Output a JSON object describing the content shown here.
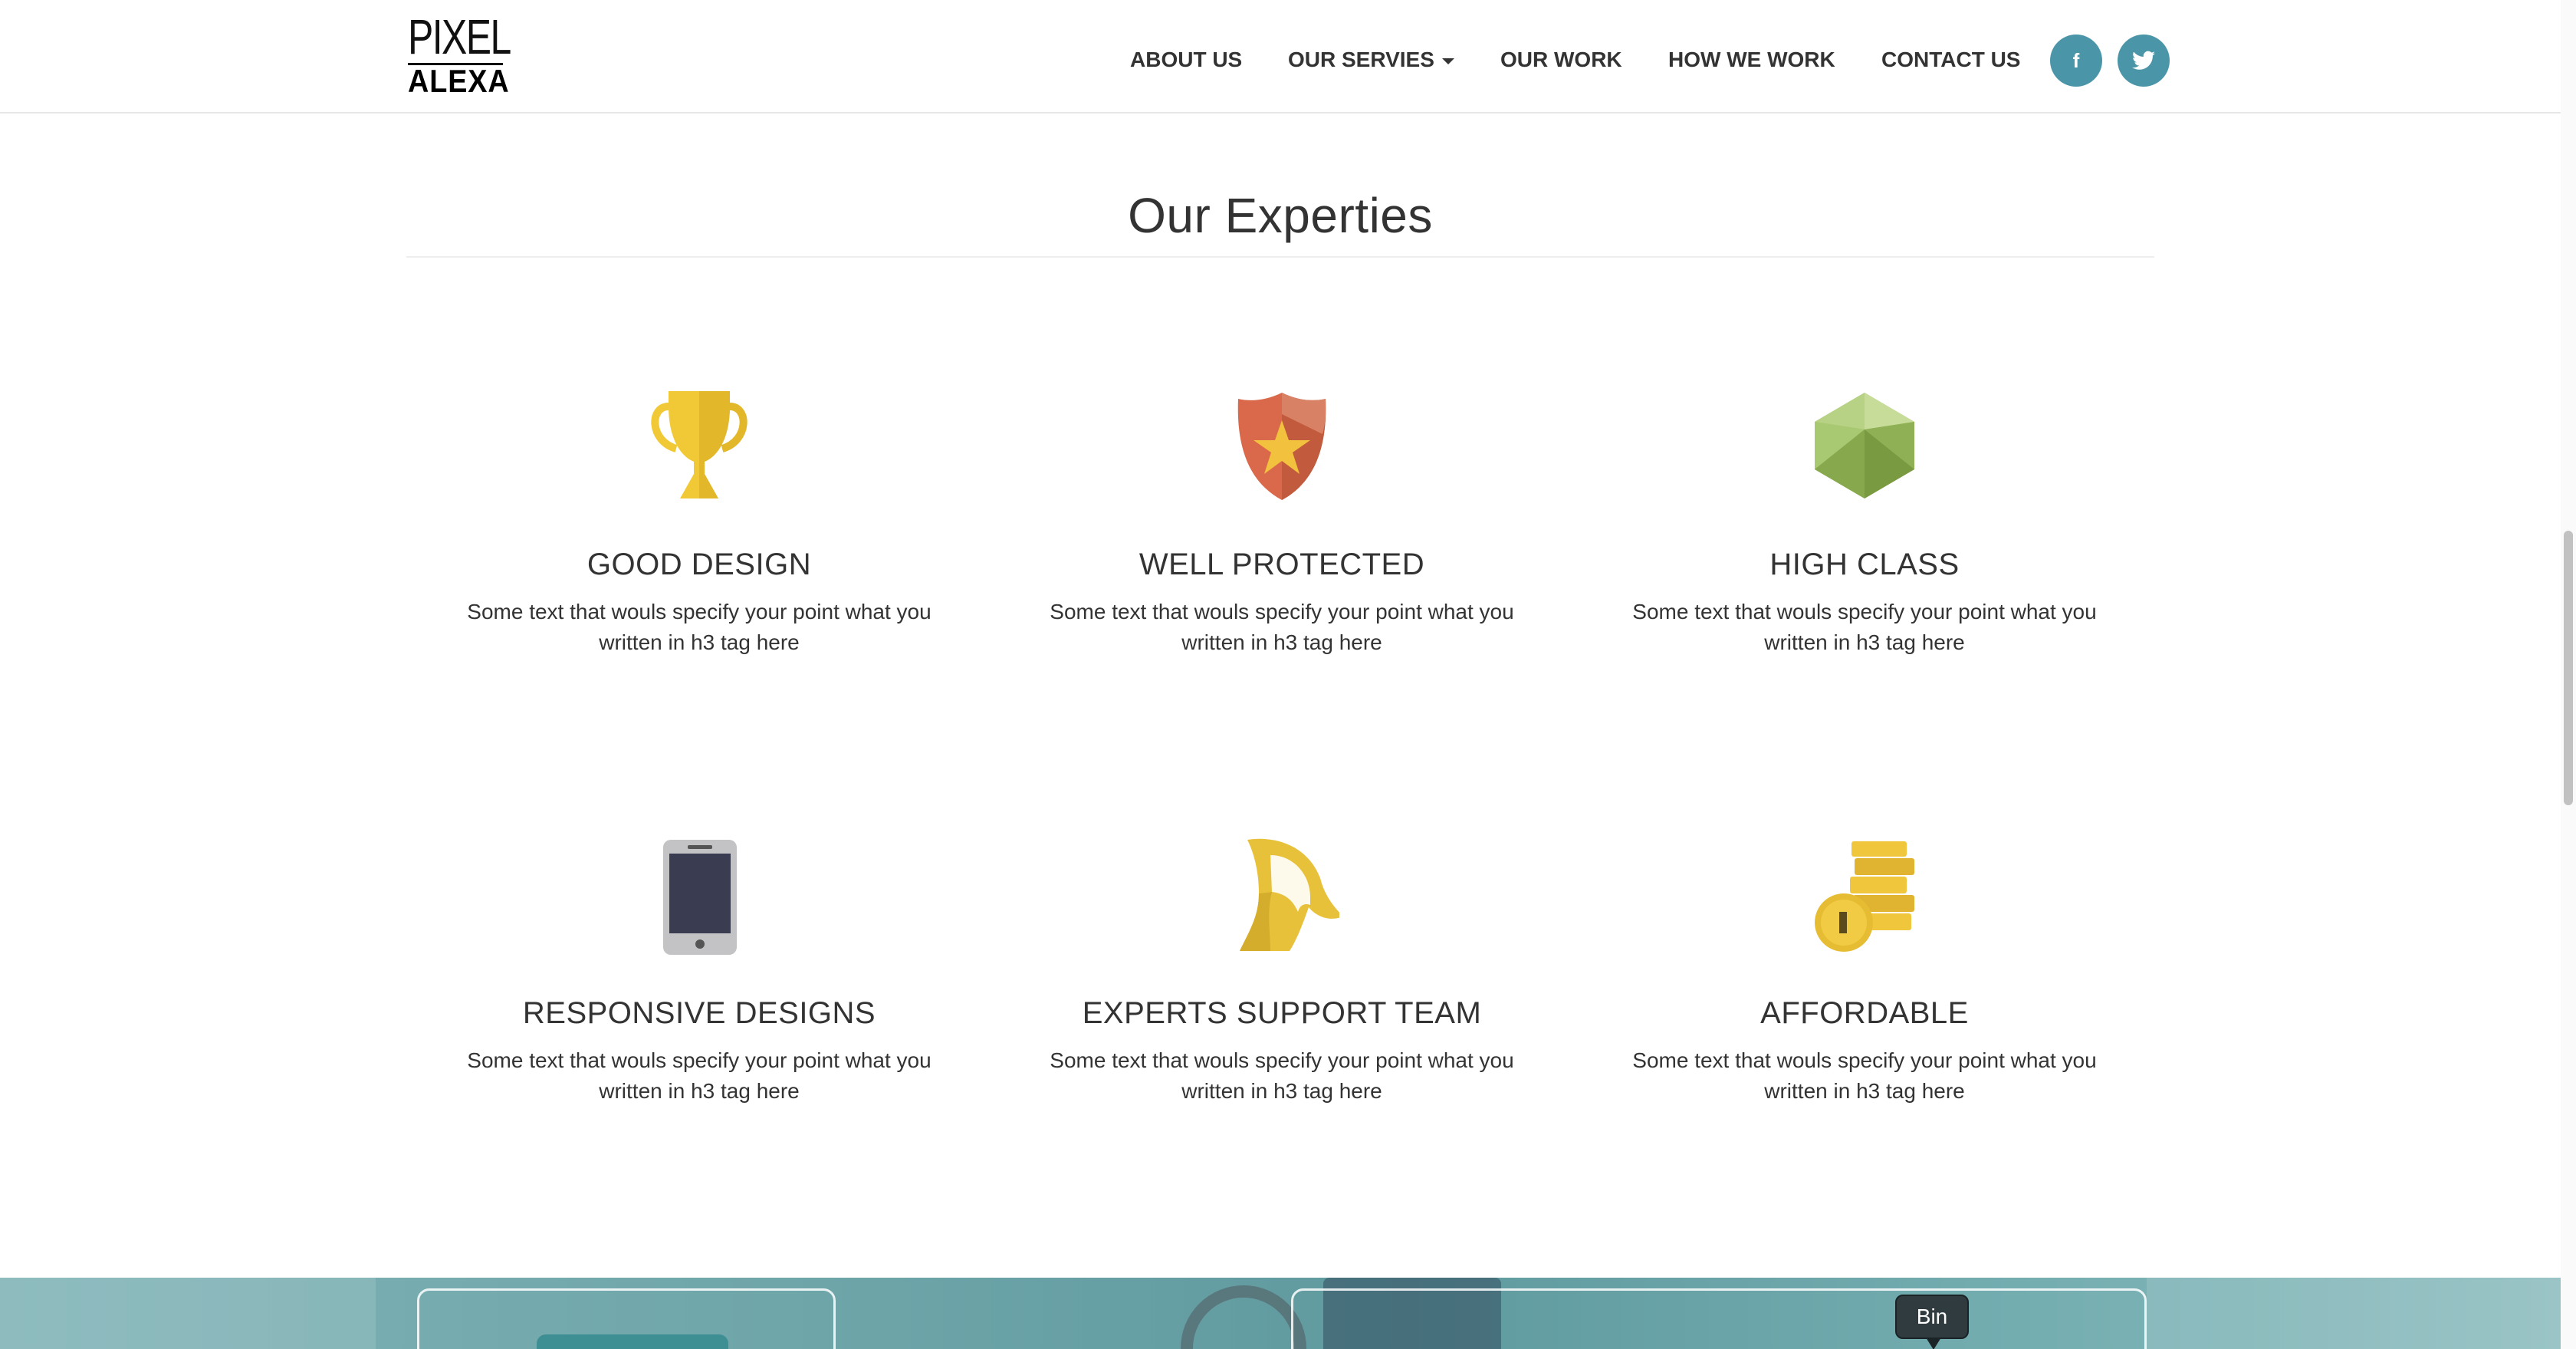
{
  "logo": {
    "line1": "PIXEL",
    "line2": "ALEXA"
  },
  "nav": {
    "items": [
      {
        "label": "ABOUT US"
      },
      {
        "label": "OUR SERVIES"
      },
      {
        "label": "OUR WORK"
      },
      {
        "label": "HOW WE WORK"
      },
      {
        "label": "CONTACT US"
      }
    ],
    "social": [
      {
        "label": "f",
        "icon": "facebook-icon"
      },
      {
        "label": "t",
        "icon": "twitter-icon"
      }
    ],
    "accent": "#4a96a8"
  },
  "section": {
    "title": "Our Experties"
  },
  "features": [
    {
      "title": "GOOD DESIGN",
      "text": "Some text that wouls specify your point what you written in h3 tag here",
      "icon": "trophy-icon"
    },
    {
      "title": "WELL PROTECTED",
      "text": "Some text that wouls specify your point what you written in h3 tag here",
      "icon": "shield-star-icon"
    },
    {
      "title": "HIGH CLASS",
      "text": "Some text that wouls specify your point what you written in h3 tag here",
      "icon": "gem-icon"
    },
    {
      "title": "RESPONSIVE DESIGNS",
      "text": "Some text that wouls specify your point what you written in h3 tag here",
      "icon": "phone-icon"
    },
    {
      "title": "EXPERTS SUPPORT TEAM",
      "text": "Some text that wouls specify your point what you written in h3 tag here",
      "icon": "spartan-helmet-icon"
    },
    {
      "title": "AFFORDABLE",
      "text": "Some text that wouls specify your point what you written in h3 tag here",
      "icon": "coins-icon"
    }
  ],
  "tooltip": {
    "text": "Bin"
  }
}
